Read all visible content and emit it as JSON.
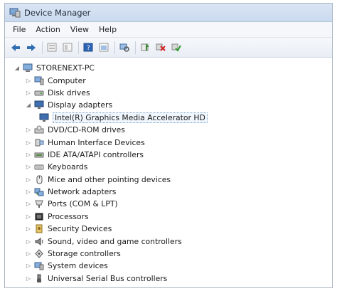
{
  "window": {
    "title": "Device Manager"
  },
  "menu": [
    "File",
    "Action",
    "View",
    "Help"
  ],
  "toolbar": {
    "buttons": [
      "back-icon",
      "forward-icon",
      "properties-icon",
      "show-hide-icon",
      "help-icon",
      "view-icon",
      "scan-hardware-icon",
      "update-driver-icon",
      "uninstall-icon",
      "enable-icon"
    ]
  },
  "tree": {
    "root": "STORENEXT-PC",
    "categories": [
      {
        "label": "Computer",
        "expanded": false,
        "icon": "computer-icon"
      },
      {
        "label": "Disk drives",
        "expanded": false,
        "icon": "disk-drive-icon"
      },
      {
        "label": "Display adapters",
        "expanded": true,
        "icon": "display-adapter-icon",
        "children": [
          {
            "label": "Intel(R) Graphics Media Accelerator HD",
            "icon": "display-device-icon",
            "selected": true
          }
        ]
      },
      {
        "label": "DVD/CD-ROM drives",
        "expanded": false,
        "icon": "dvd-icon"
      },
      {
        "label": "Human Interface Devices",
        "expanded": false,
        "icon": "hid-icon"
      },
      {
        "label": "IDE ATA/ATAPI controllers",
        "expanded": false,
        "icon": "ide-controller-icon"
      },
      {
        "label": "Keyboards",
        "expanded": false,
        "icon": "keyboard-icon"
      },
      {
        "label": "Mice and other pointing devices",
        "expanded": false,
        "icon": "mouse-icon"
      },
      {
        "label": "Network adapters",
        "expanded": false,
        "icon": "network-adapter-icon"
      },
      {
        "label": "Ports (COM & LPT)",
        "expanded": false,
        "icon": "port-icon"
      },
      {
        "label": "Processors",
        "expanded": false,
        "icon": "processor-icon"
      },
      {
        "label": "Security Devices",
        "expanded": false,
        "icon": "security-device-icon"
      },
      {
        "label": "Sound, video and game controllers",
        "expanded": false,
        "icon": "sound-icon"
      },
      {
        "label": "Storage controllers",
        "expanded": false,
        "icon": "storage-controller-icon"
      },
      {
        "label": "System devices",
        "expanded": false,
        "icon": "system-device-icon"
      },
      {
        "label": "Universal Serial Bus controllers",
        "expanded": false,
        "icon": "usb-icon"
      }
    ]
  }
}
